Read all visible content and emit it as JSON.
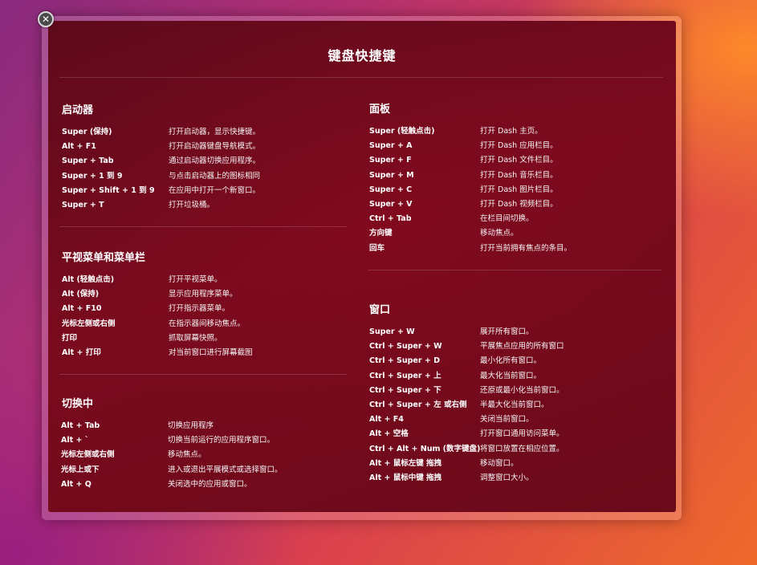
{
  "close_button": {
    "icon": "close-icon",
    "glyph": "✕"
  },
  "title": "键盘快捷键",
  "sections": {
    "launcher": {
      "title": "启动器",
      "rows": [
        {
          "key": "Super (保持)",
          "desc": "打开启动器，显示快捷键。"
        },
        {
          "key": "Alt + F1",
          "desc": "打开启动器键盘导航模式。"
        },
        {
          "key": "Super + Tab",
          "desc": "通过启动器切换应用程序。"
        },
        {
          "key": "Super + 1 到 9",
          "desc": "与点击启动器上的图标相同"
        },
        {
          "key": "Super + Shift + 1 到 9",
          "desc": "在应用中打开一个新窗口。"
        },
        {
          "key": "Super + T",
          "desc": "打开垃圾桶。"
        }
      ]
    },
    "hud_menubar": {
      "title": "平视菜单和菜单栏",
      "rows": [
        {
          "key": "Alt (轻触点击)",
          "desc": "打开平视菜单。"
        },
        {
          "key": "Alt (保持)",
          "desc": "显示应用程序菜单。"
        },
        {
          "key": "Alt + F10",
          "desc": "打开指示器菜单。"
        },
        {
          "key": "光标左侧或右侧",
          "desc": "在指示器间移动焦点。"
        },
        {
          "key": "打印",
          "desc": "抓取屏幕快照。"
        },
        {
          "key": "Alt + 打印",
          "desc": "对当前窗口进行屏幕截图"
        }
      ]
    },
    "switching": {
      "title": "切换中",
      "rows": [
        {
          "key": "Alt + Tab",
          "desc": "切换应用程序"
        },
        {
          "key": "Alt + `",
          "desc": "切换当前运行的应用程序窗口。"
        },
        {
          "key": "光标左侧或右侧",
          "desc": "移动焦点。"
        },
        {
          "key": "光标上或下",
          "desc": "进入或退出平展模式或选择窗口。"
        },
        {
          "key": "Alt + Q",
          "desc": "关闭选中的应用或窗口。"
        }
      ]
    },
    "dash": {
      "title": "面板",
      "rows": [
        {
          "key": "Super (轻触点击)",
          "desc": "打开 Dash 主页。"
        },
        {
          "key": "Super + A",
          "desc": "打开 Dash 应用栏目。"
        },
        {
          "key": "Super + F",
          "desc": "打开 Dash 文件栏目。"
        },
        {
          "key": "Super + M",
          "desc": "打开 Dash 音乐栏目。"
        },
        {
          "key": "Super + C",
          "desc": "打开 Dash 图片栏目。"
        },
        {
          "key": "Super + V",
          "desc": "打开 Dash 视频栏目。"
        },
        {
          "key": "Ctrl + Tab",
          "desc": "在栏目间切换。"
        },
        {
          "key": "方向键",
          "desc": "移动焦点。"
        },
        {
          "key": "回车",
          "desc": "打开当前拥有焦点的条目。"
        }
      ]
    },
    "windows": {
      "title": "窗口",
      "rows": [
        {
          "key": "Super + W",
          "desc": "展开所有窗口。"
        },
        {
          "key": "Ctrl + Super + W",
          "desc": "平展焦点应用的所有窗口"
        },
        {
          "key": "Ctrl + Super + D",
          "desc": "最小化所有窗口。"
        },
        {
          "key": "Ctrl + Super + 上",
          "desc": "最大化当前窗口。"
        },
        {
          "key": "Ctrl + Super + 下",
          "desc": "还原或最小化当前窗口。"
        },
        {
          "key": "Ctrl + Super + 左 或右侧",
          "desc": "半最大化当前窗口。"
        },
        {
          "key": "Alt + F4",
          "desc": "关闭当前窗口。"
        },
        {
          "key": "Alt + 空格",
          "desc": "打开窗口通用访问菜单。"
        },
        {
          "key": "Ctrl + Alt + Num (数字键盘)",
          "desc": "将窗口放置在相应位置。"
        },
        {
          "key": "Alt + 鼠标左键 拖拽",
          "desc": "移动窗口。"
        },
        {
          "key": "Alt + 鼠标中键 拖拽",
          "desc": "调整窗口大小。"
        }
      ]
    }
  }
}
